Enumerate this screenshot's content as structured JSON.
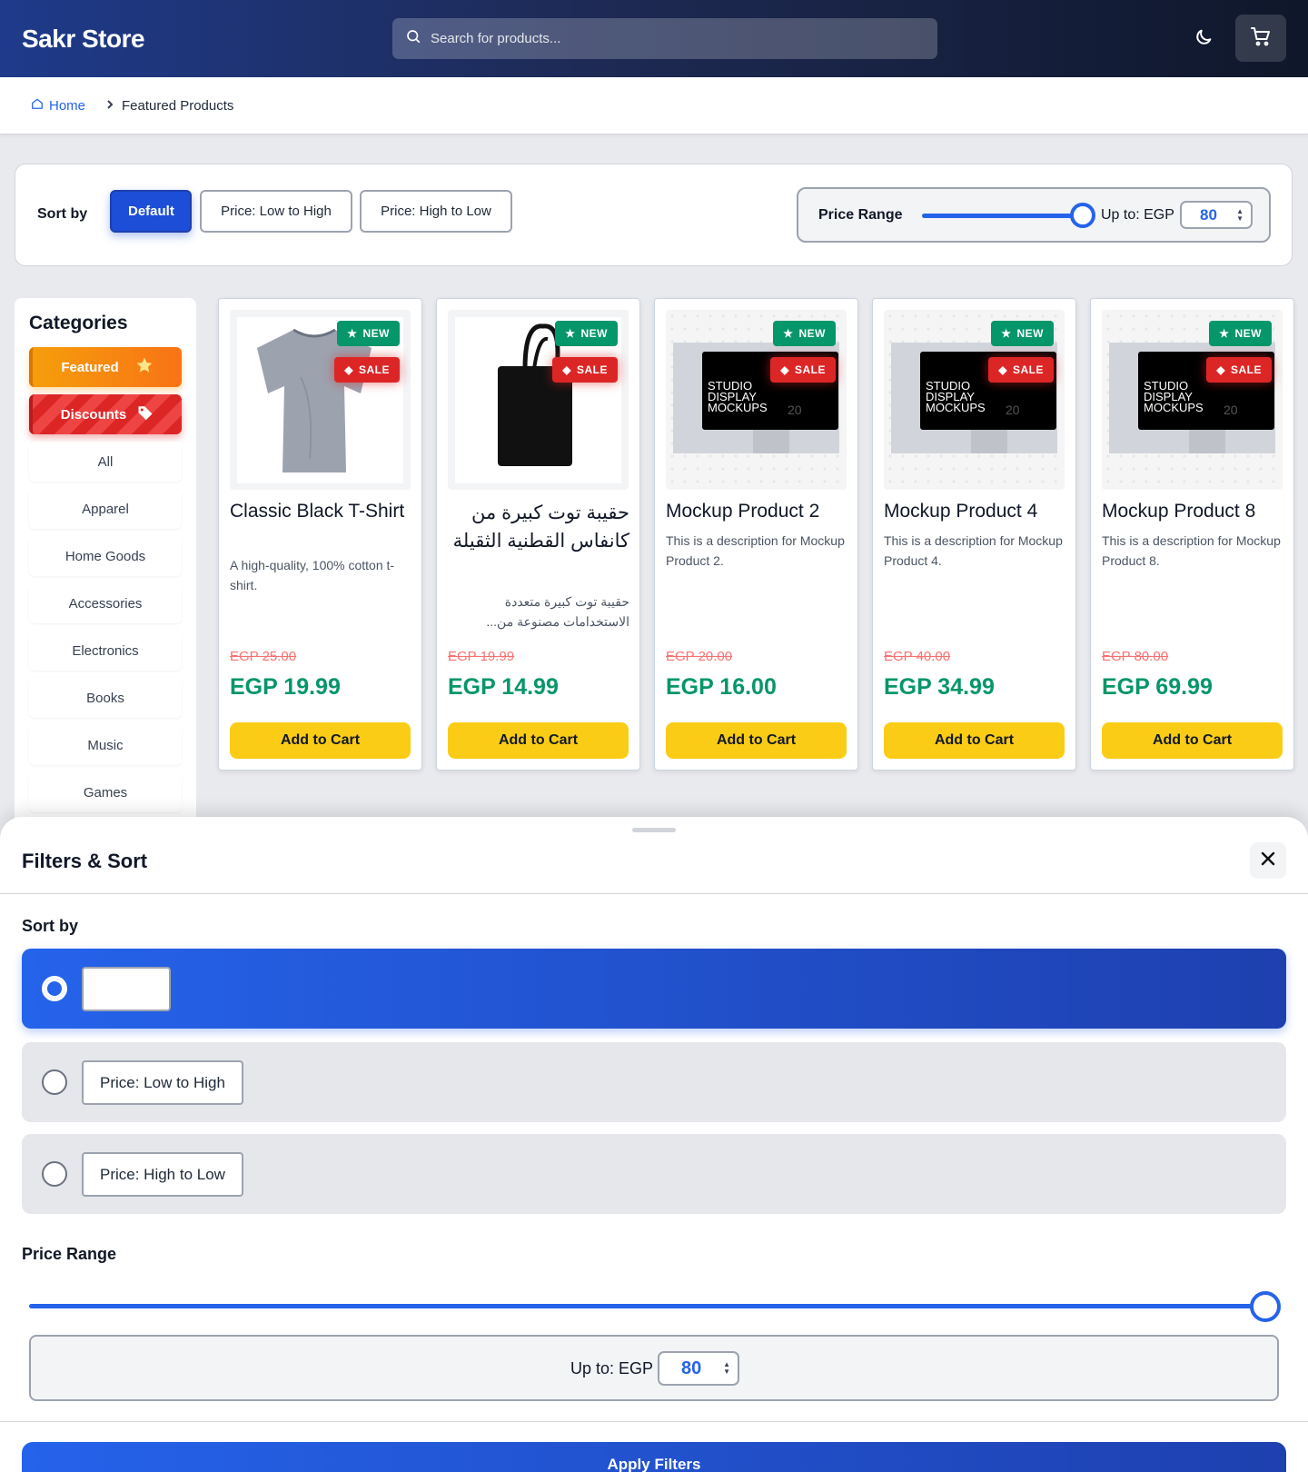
{
  "header": {
    "logo": "Sakr Store",
    "search_placeholder": "Search for products...",
    "icons": {
      "search": "search-icon",
      "theme": "moon-icon",
      "cart": "cart-icon"
    }
  },
  "breadcrumb": {
    "home": "Home",
    "current": "Featured Products"
  },
  "toolbar": {
    "sort_label": "Sort by",
    "sort_options": [
      "Default",
      "Price: Low to High",
      "Price: High to Low"
    ],
    "selected_sort": "Default",
    "price_range_label": "Price Range",
    "up_to_label": "Up to: EGP",
    "price_max": "80"
  },
  "sidebar": {
    "title": "Categories",
    "featured": "Featured",
    "discounts": "Discounts",
    "categories": [
      "All",
      "Apparel",
      "Home Goods",
      "Accessories",
      "Electronics",
      "Books",
      "Music",
      "Games"
    ]
  },
  "badges": {
    "new": "NEW",
    "sale": "SALE"
  },
  "products": [
    {
      "title": "Classic Black T-Shirt",
      "description": "A high-quality, 100% cotton t-shirt.",
      "old_price": "EGP 25.00",
      "price": "EGP 19.99",
      "image": "tshirt",
      "rtl": false
    },
    {
      "title": "حقيبة توت كبيرة من كانفاس القطنية الثقيلة",
      "description": "حقيبة توت كبيرة متعددة الاستخدامات مصنوعة من...",
      "old_price": "EGP 19.99",
      "price": "EGP 14.99",
      "image": "tote",
      "rtl": true
    },
    {
      "title": "Mockup Product 2",
      "description": "This is a description for Mockup Product 2.",
      "old_price": "EGP 20.00",
      "price": "EGP 16.00",
      "image": "mockup",
      "rtl": false
    },
    {
      "title": "Mockup Product 4",
      "description": "This is a description for Mockup Product 4.",
      "old_price": "EGP 40.00",
      "price": "EGP 34.99",
      "image": "mockup",
      "rtl": false
    },
    {
      "title": "Mockup Product 8",
      "description": "This is a description for Mockup Product 8.",
      "old_price": "EGP 80.00",
      "price": "EGP 69.99",
      "image": "mockup",
      "rtl": false
    }
  ],
  "add_to_cart": "Add to Cart",
  "mockup_text": [
    "STUDIO",
    "DISPLAY",
    "MOCKUPS",
    "20"
  ],
  "sheet": {
    "title": "Filters & Sort",
    "sort_label": "Sort by",
    "options": [
      "",
      "Price: Low to High",
      "Price: High to Low"
    ],
    "selected_index": 0,
    "price_range_label": "Price Range",
    "up_to_label": "Up to: EGP",
    "price_max": "80",
    "apply_label": "Apply Filters"
  },
  "colors": {
    "primary": "#2563eb",
    "accent_yellow": "#facc15",
    "price_green": "#059669",
    "sale_red": "#dc2626",
    "featured_orange": "#f59e0b"
  }
}
